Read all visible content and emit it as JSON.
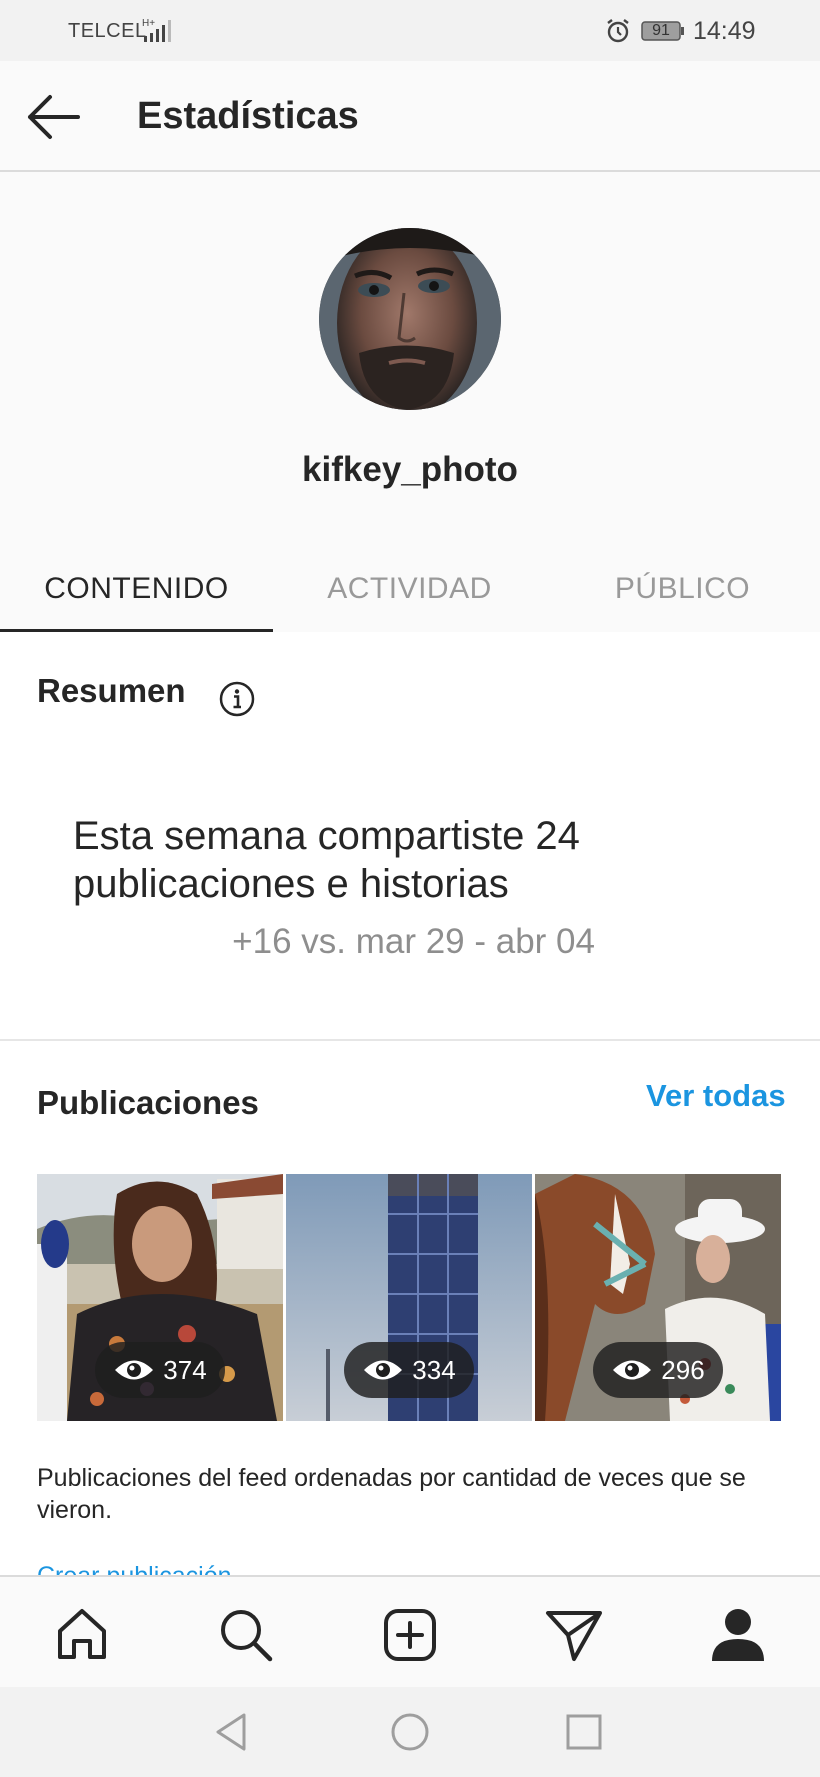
{
  "status_bar": {
    "carrier": "TELCEL",
    "network": "H+",
    "battery": "91",
    "time": "14:49"
  },
  "header": {
    "title": "Estadísticas",
    "back_icon": "arrow-left-icon"
  },
  "profile": {
    "username": "kifkey_photo"
  },
  "tabs": [
    {
      "label": "CONTENIDO",
      "active": true
    },
    {
      "label": "ACTIVIDAD",
      "active": false
    },
    {
      "label": "PÚBLICO",
      "active": false
    }
  ],
  "summary": {
    "title": "Resumen",
    "main_text": "Esta semana compartiste 24 publicaciones e historias",
    "comparison": "+16 vs. mar 29 - abr 04"
  },
  "posts": {
    "title": "Publicaciones",
    "see_all": "Ver todas",
    "items": [
      {
        "views": "374",
        "subject": "woman-floral-dress"
      },
      {
        "views": "334",
        "subject": "blue-tower"
      },
      {
        "views": "296",
        "subject": "horse-and-woman"
      }
    ],
    "note": "Publicaciones del feed ordenadas por cantidad de veces que se vieron.",
    "cut_link": "Crear publicación"
  },
  "bottom_nav": [
    "home-icon",
    "search-icon",
    "new-post-icon",
    "direct-icon",
    "profile-icon"
  ],
  "colors": {
    "link": "#1b95e0",
    "text": "#262626",
    "muted": "#8e8e8e"
  }
}
